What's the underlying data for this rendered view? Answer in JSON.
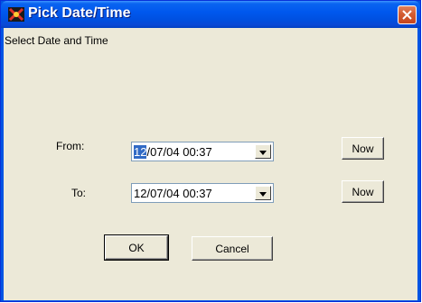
{
  "window": {
    "title": "Pick Date/Time",
    "icon": "app-icon",
    "close_icon": "close-icon"
  },
  "dialog": {
    "heading": "Select Date and Time",
    "from": {
      "label": "From:",
      "value_selected": "12",
      "value_rest": "/07/04 00:37",
      "now_label": "Now"
    },
    "to": {
      "label": "To:",
      "value": "12/07/04 00:37",
      "now_label": "Now"
    },
    "ok_label": "OK",
    "cancel_label": "Cancel"
  },
  "colors": {
    "title_bar": "#0054e3",
    "close_button": "#d25c32",
    "client_bg": "#ece9d8",
    "selection": "#316ac5"
  }
}
